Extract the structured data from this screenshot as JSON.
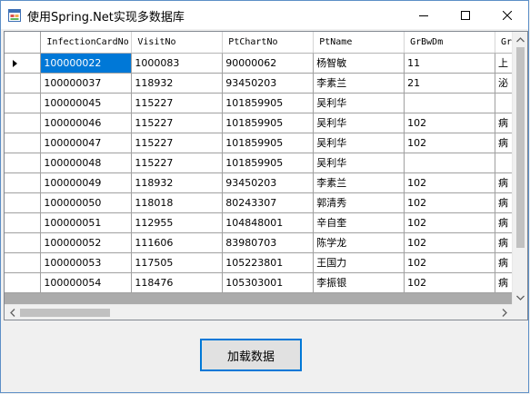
{
  "window": {
    "title": "使用Spring.Net实现多数据库",
    "controls": [
      "minimize-icon",
      "maximize-icon",
      "close-icon"
    ]
  },
  "grid": {
    "columns": [
      "InfectionCardNo",
      "VisitNo",
      "PtChartNo",
      "PtName",
      "GrBwDm",
      "Gr"
    ],
    "rows": [
      [
        "100000022",
        "1000083",
        "90000062",
        "杨智敏",
        "11",
        "上"
      ],
      [
        "100000037",
        "118932",
        "93450203",
        "李素兰",
        "21",
        "泌"
      ],
      [
        "100000045",
        "115227",
        "101859905",
        "吴利华",
        "",
        ""
      ],
      [
        "100000046",
        "115227",
        "101859905",
        "吴利华",
        "102",
        "病"
      ],
      [
        "100000047",
        "115227",
        "101859905",
        "吴利华",
        "102",
        "病"
      ],
      [
        "100000048",
        "115227",
        "101859905",
        "吴利华",
        "",
        ""
      ],
      [
        "100000049",
        "118932",
        "93450203",
        "李素兰",
        "102",
        "病"
      ],
      [
        "100000050",
        "118018",
        "80243307",
        "郭清秀",
        "102",
        "病"
      ],
      [
        "100000051",
        "112955",
        "104848001",
        "辛自奎",
        "102",
        "病"
      ],
      [
        "100000052",
        "111606",
        "83980703",
        "陈学龙",
        "102",
        "病"
      ],
      [
        "100000053",
        "117505",
        "105223801",
        "王国力",
        "102",
        "病"
      ],
      [
        "100000054",
        "118476",
        "105303001",
        "李振银",
        "102",
        "病"
      ]
    ],
    "selected_row": 0,
    "selected_cell": "100000022"
  },
  "actions": {
    "load_button_label": "加载数据"
  }
}
